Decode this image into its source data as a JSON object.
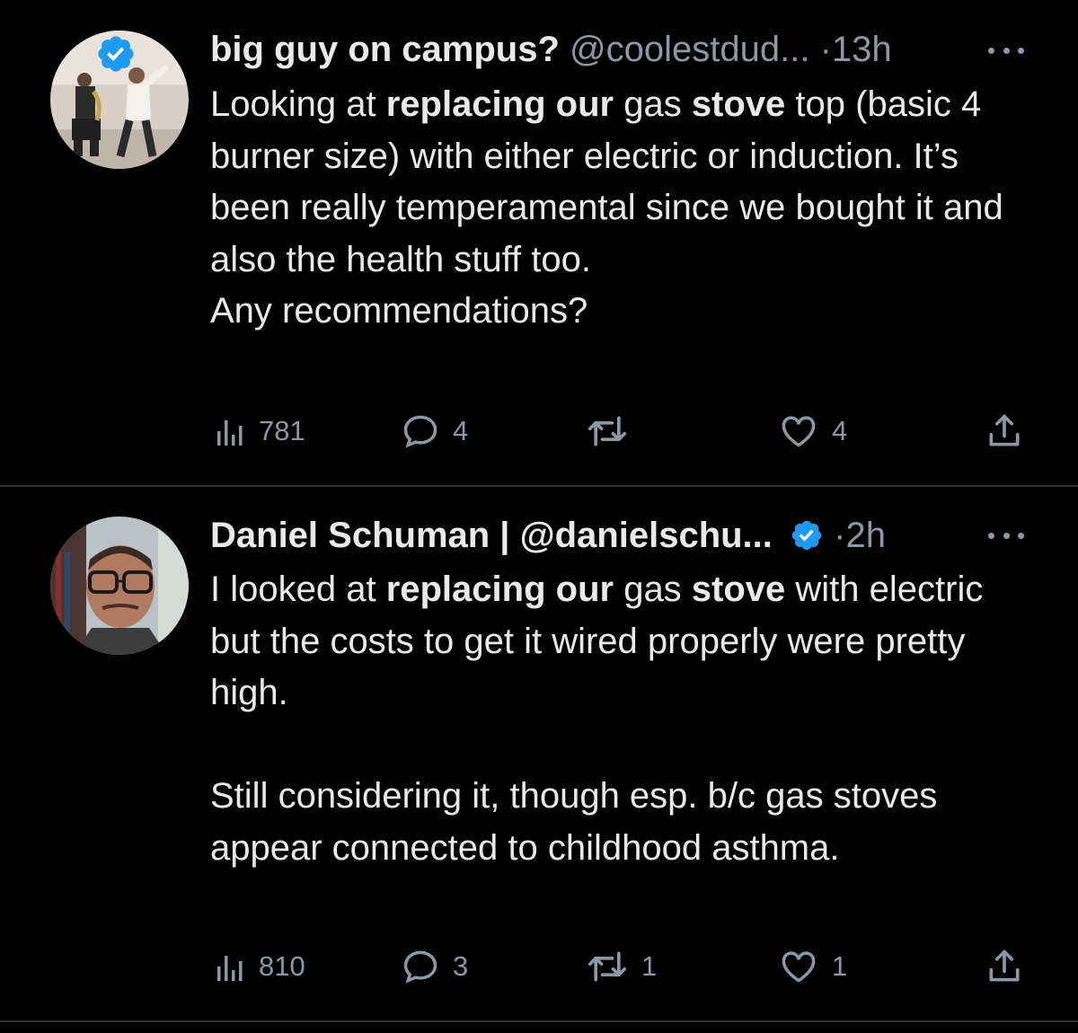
{
  "colors": {
    "background": "#000000",
    "text": "#e7e9ea",
    "muted": "#8b98a5",
    "verified": "#1d9bf0",
    "divider": "#2f3336"
  },
  "tweets": [
    {
      "name": "big guy on campus?",
      "handle": "@coolestdud...",
      "dot": "·",
      "time": "13h",
      "body": {
        "p1_a": "Looking at ",
        "p1_b": "replacing our",
        "p1_c": " gas ",
        "p1_d": "stove",
        "p1_e": " top (basic 4 burner size) with either electric or induction. It’s been really temperamental since we bought it and also the health stuff too.",
        "p2": "Any recommendations?"
      },
      "stats": {
        "views": "781",
        "replies": "4",
        "retweets": "",
        "likes": "4"
      }
    },
    {
      "name": "Daniel Schuman | @danielschu...",
      "dot": "·",
      "time": "2h",
      "body": {
        "p1_a": "I looked at ",
        "p1_b": "replacing our",
        "p1_c": " gas ",
        "p1_d": "stove",
        "p1_e": " with electric but the costs to get it wired properly were pretty high.",
        "p2": "Still considering it, though esp. b/c gas stoves appear connected to childhood asthma."
      },
      "stats": {
        "views": "810",
        "replies": "3",
        "retweets": "1",
        "likes": "1"
      }
    }
  ],
  "icons": [
    "verified-badge-icon",
    "more-icon",
    "views-icon",
    "reply-icon",
    "retweet-icon",
    "like-icon",
    "share-icon"
  ]
}
